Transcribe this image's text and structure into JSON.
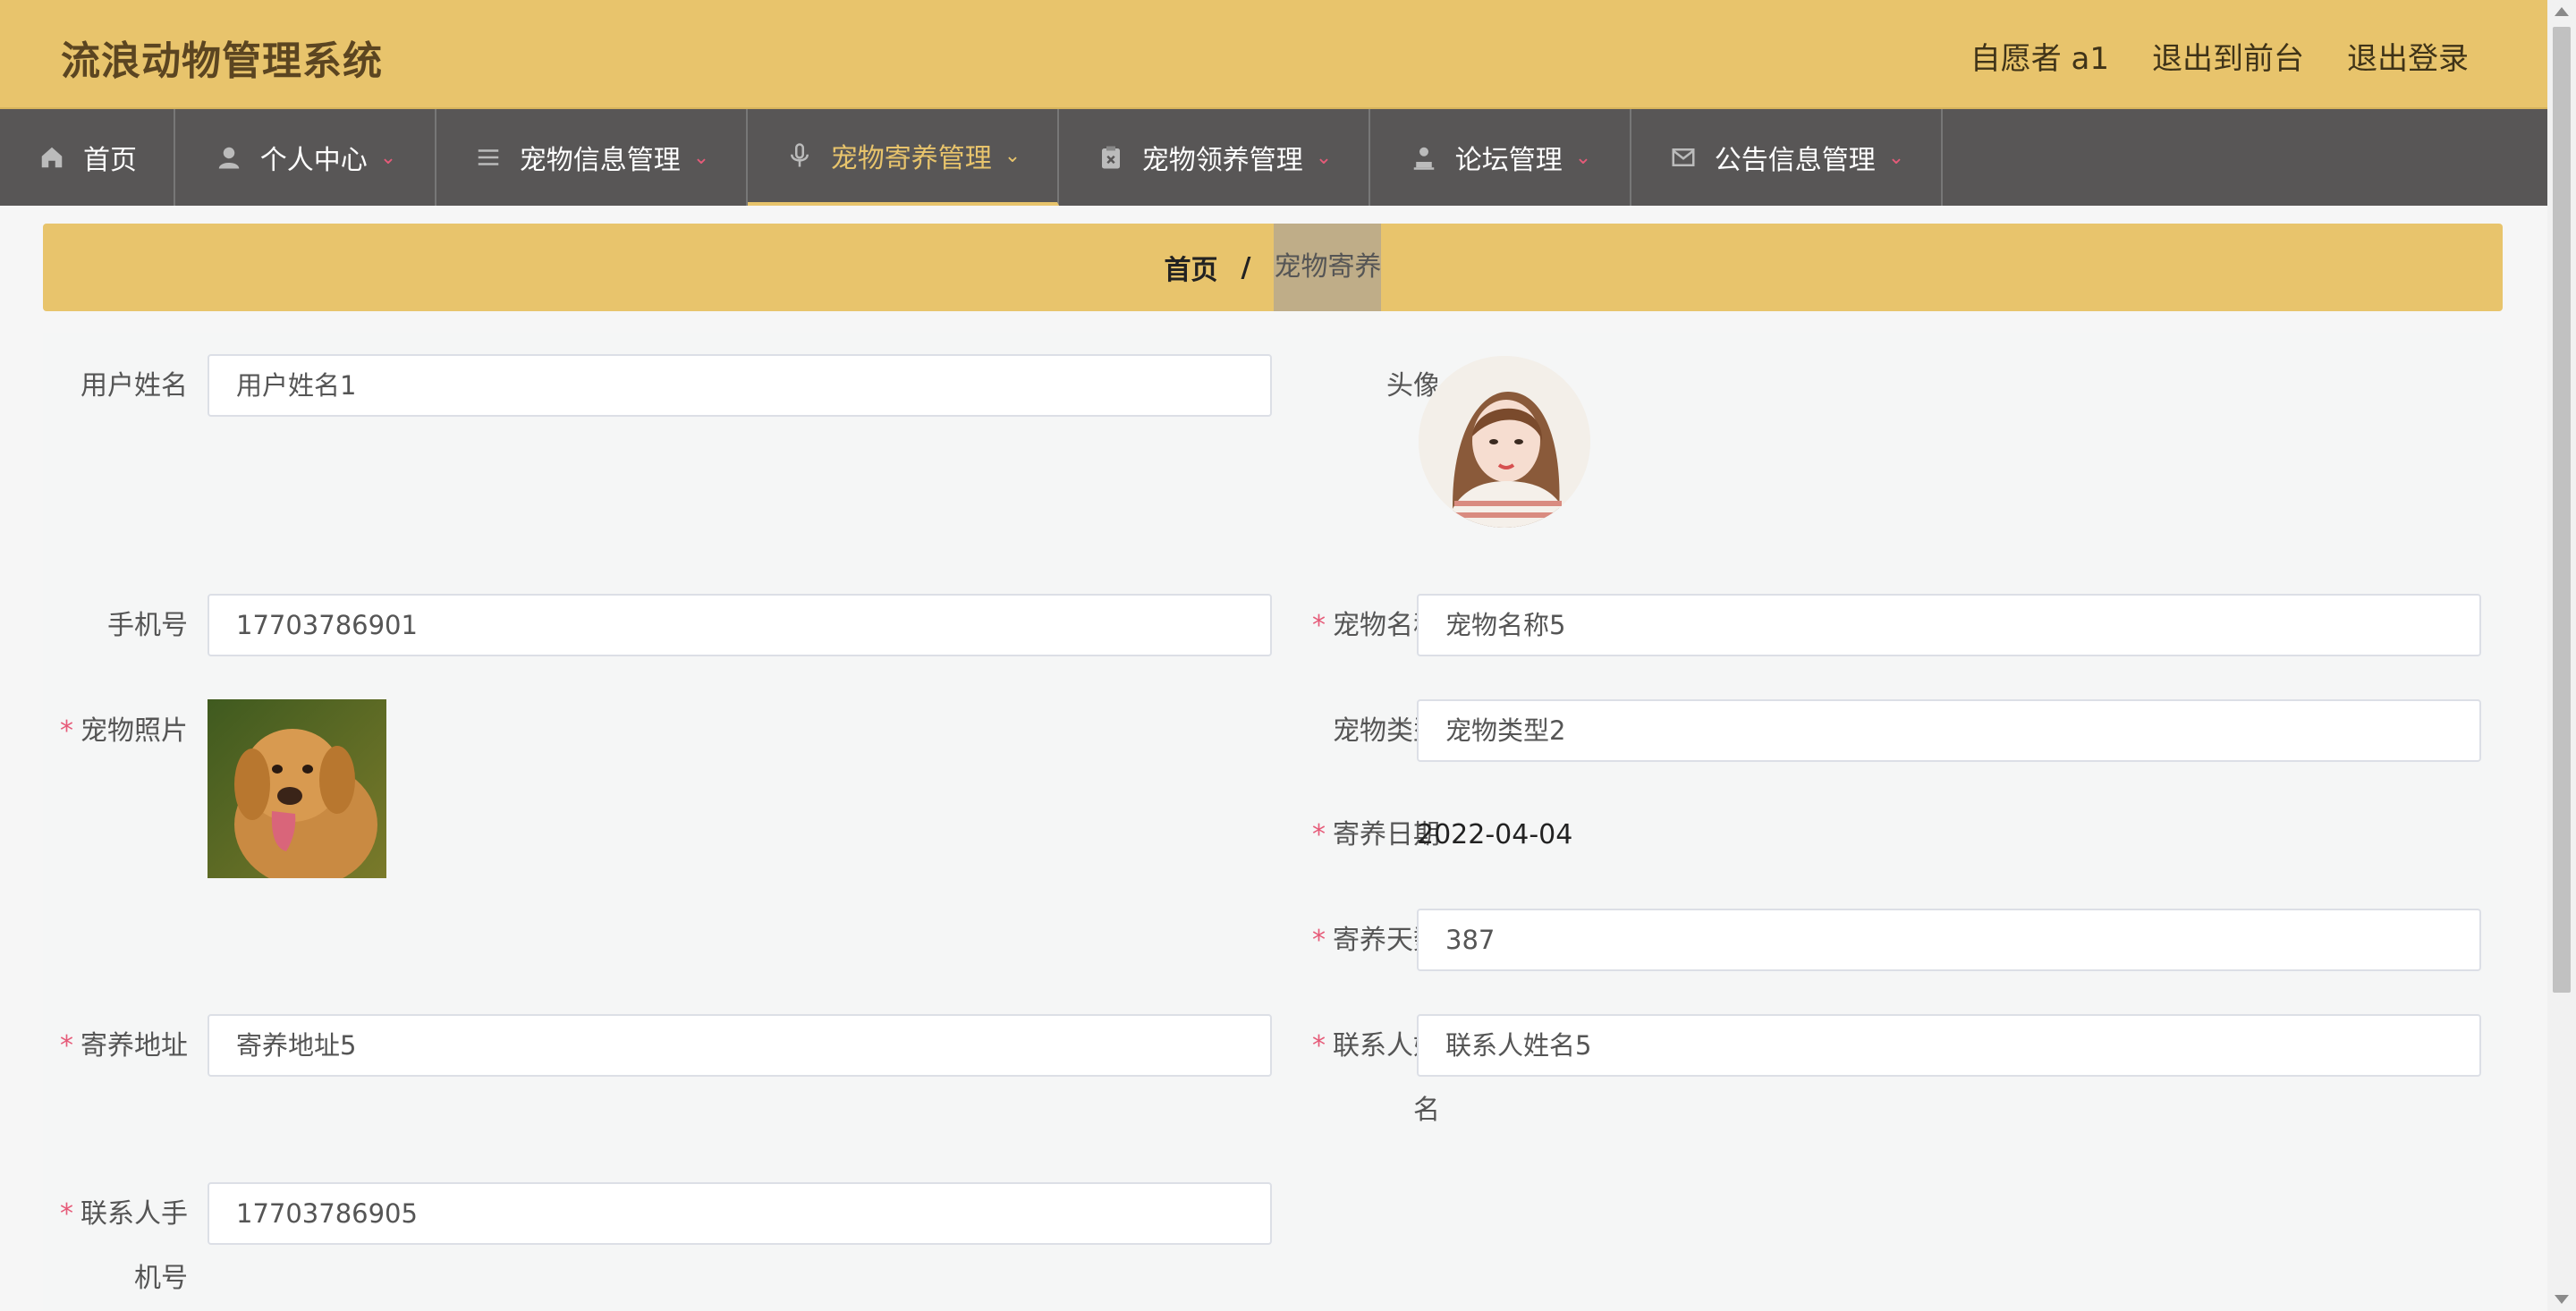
{
  "header": {
    "title": "流浪动物管理系统",
    "user_label": "自愿者 a1",
    "to_frontend": "退出到前台",
    "logout": "退出登录"
  },
  "nav": {
    "items": [
      {
        "label": "首页",
        "icon": "home-icon"
      },
      {
        "label": "个人中心",
        "icon": "user-icon"
      },
      {
        "label": "宠物信息管理",
        "icon": "list-icon"
      },
      {
        "label": "宠物寄养管理",
        "icon": "microphone-icon",
        "active": true
      },
      {
        "label": "宠物领养管理",
        "icon": "clipboard-icon"
      },
      {
        "label": "论坛管理",
        "icon": "person-icon"
      },
      {
        "label": "公告信息管理",
        "icon": "mail-icon"
      }
    ]
  },
  "breadcrumb": {
    "home": "首页",
    "separator": "/",
    "current": "宠物寄养"
  },
  "form": {
    "username_label": "用户姓名",
    "username_value": "用户姓名1",
    "avatar_label": "头像",
    "phone_label": "手机号",
    "phone_value": "17703786901",
    "pet_name_label": "宠物名称",
    "pet_name_value": "宠物名称5",
    "pet_photo_label": "宠物照片",
    "pet_type_label": "宠物类型",
    "pet_type_value": "宠物类型2",
    "foster_date_label": "寄养日期",
    "foster_date_value": "2022-04-04",
    "foster_days_label": "寄养天数",
    "foster_days_value": "387",
    "foster_address_label": "寄养地址",
    "foster_address_value": "寄养地址5",
    "contact_name_label_1": "联系人姓",
    "contact_name_label_2": "名",
    "contact_name_value": "联系人姓名5",
    "contact_phone_label_1": "联系人手",
    "contact_phone_label_2": "机号",
    "contact_phone_value": "17703786905",
    "required_mark": "*"
  },
  "colors": {
    "accent": "#e8c46c",
    "nav_bg": "#585656",
    "required": "#e65b79"
  }
}
